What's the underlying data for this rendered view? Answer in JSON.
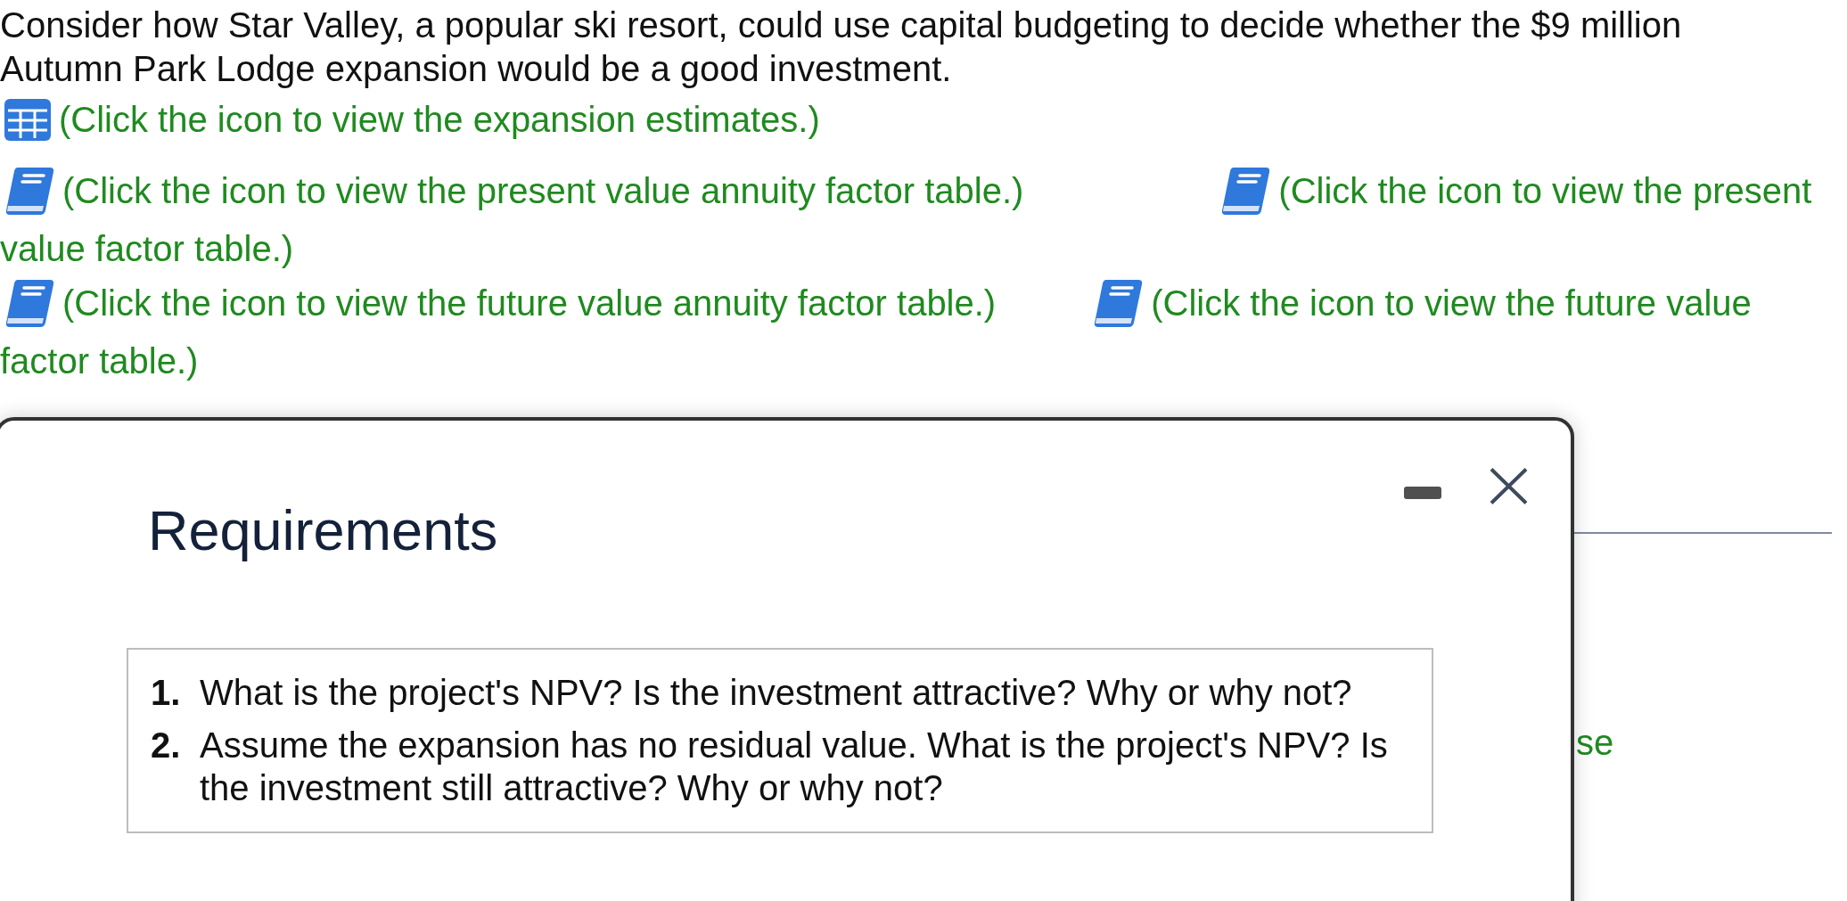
{
  "question": {
    "text": "Consider how Star Valley, a popular ski resort, could use capital budgeting to decide whether the $9 million Autumn Park Lodge expansion would be a good investment."
  },
  "link_rows": [
    {
      "links": [
        {
          "kind": "table",
          "lines": [
            "(Click the icon to view the expansion estimates.)"
          ]
        }
      ]
    },
    {
      "links": [
        {
          "kind": "book",
          "lines": [
            "(Click the icon to view the present value annuity factor table.)"
          ]
        },
        {
          "kind": "book",
          "lines": [
            "(Click the icon to view the present",
            "value factor table.)"
          ]
        }
      ]
    },
    {
      "links": [
        {
          "kind": "book",
          "lines": [
            "(Click the icon to view the future value annuity factor table.)"
          ]
        },
        {
          "kind": "book",
          "lines": [
            "(Click the icon to view the future value",
            "factor table.)"
          ]
        }
      ]
    }
  ],
  "background": {
    "partial_text": "se"
  },
  "dialog": {
    "title": "Requirements",
    "requirements": [
      {
        "number": "1.",
        "text": "What is the project's NPV? Is the investment attractive? Why or why not?"
      },
      {
        "number": "2.",
        "text": "Assume the expansion has no residual value. What is the project's NPV? Is the investment still attractive? Why or why not?"
      }
    ]
  }
}
